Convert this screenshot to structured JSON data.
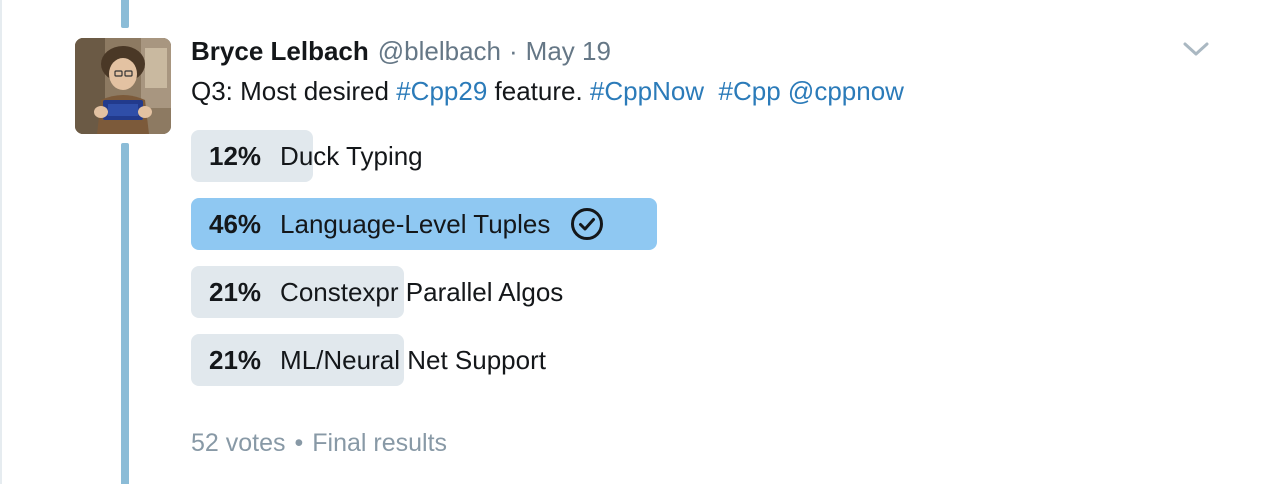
{
  "tweet": {
    "author_name": "Bryce Lelbach",
    "handle": "@blelbach",
    "separator": "·",
    "date": "May 19",
    "text_segments": [
      {
        "text": "Q3: Most desired ",
        "link": false
      },
      {
        "text": "#Cpp29",
        "link": true
      },
      {
        "text": " feature. ",
        "link": false
      },
      {
        "text": "#CppNow",
        "link": true
      },
      {
        "text": "  ",
        "link": false
      },
      {
        "text": "#Cpp",
        "link": true
      },
      {
        "text": " ",
        "link": false
      },
      {
        "text": "@cppnow",
        "link": true
      }
    ]
  },
  "poll": {
    "options": [
      {
        "percent_label": "12%",
        "label": "Duck Typing",
        "fraction": 0.12,
        "winner": false
      },
      {
        "percent_label": "46%",
        "label": "Language-Level Tuples",
        "fraction": 0.46,
        "winner": true
      },
      {
        "percent_label": "21%",
        "label": "Constexpr Parallel Algos",
        "fraction": 0.21,
        "winner": false
      },
      {
        "percent_label": "21%",
        "label": "ML/Neural Net Support",
        "fraction": 0.21,
        "winner": false
      }
    ],
    "votes": "52 votes",
    "footer_separator": "•",
    "status": "Final results"
  },
  "icons": {
    "caret": "chevron-down-icon",
    "winner_check": "check-circle-icon"
  },
  "colors": {
    "link": "#2b7bb9",
    "thread_line": "#8bbcd7",
    "winner_bar": "#8fc8f2",
    "bar": "#e1e8ed",
    "muted_text": "#657786",
    "footer_text": "#8899a6"
  }
}
